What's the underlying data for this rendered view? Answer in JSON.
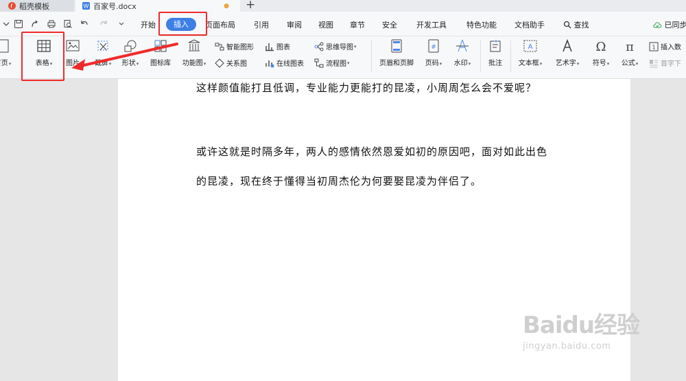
{
  "tabs": [
    {
      "label": "稻壳模板"
    },
    {
      "label": "百家号.docx"
    }
  ],
  "menu": {
    "items": [
      "开始",
      "插入",
      "页面布局",
      "引用",
      "审阅",
      "视图",
      "章节",
      "安全",
      "开发工具",
      "特色功能",
      "文档助手"
    ],
    "search": "查找",
    "sync": "已同步"
  },
  "ribbon": {
    "cover": "首页",
    "table": "表格",
    "picture": "图片",
    "screenshot": "截屏",
    "shape": "形状",
    "icon_lib": "图标库",
    "func_chart": "功能图",
    "smart_shape": "智能图形",
    "chart": "图表",
    "mindmap": "思维导图",
    "relation": "关系图",
    "online_chart": "在线图表",
    "flowchart": "流程图",
    "header_footer": "页眉和页脚",
    "page_number": "页码",
    "watermark": "水印",
    "comment": "批注",
    "textbox": "文本框",
    "wordart": "艺术字",
    "symbol": "符号",
    "formula": "公式",
    "insert_number": "插入数",
    "dropcap": "首字下"
  },
  "document": {
    "paragraphs": [
      "这样颜值能打且低调，专业能力更能打的昆凌，小周周怎么会不爱呢？",
      "或许这就是时隔多年，两人的感情依然恩爱如初的原因吧，面对如此出色的昆凌，现在终于懂得当初周杰伦为何要娶昆凌为伴侣了。"
    ]
  },
  "watermark": {
    "logo": "Baidu经验",
    "url": "jingyan.baidu.com"
  },
  "colors": {
    "accent": "#3e7fe5",
    "annotation": "#f02a2a"
  }
}
